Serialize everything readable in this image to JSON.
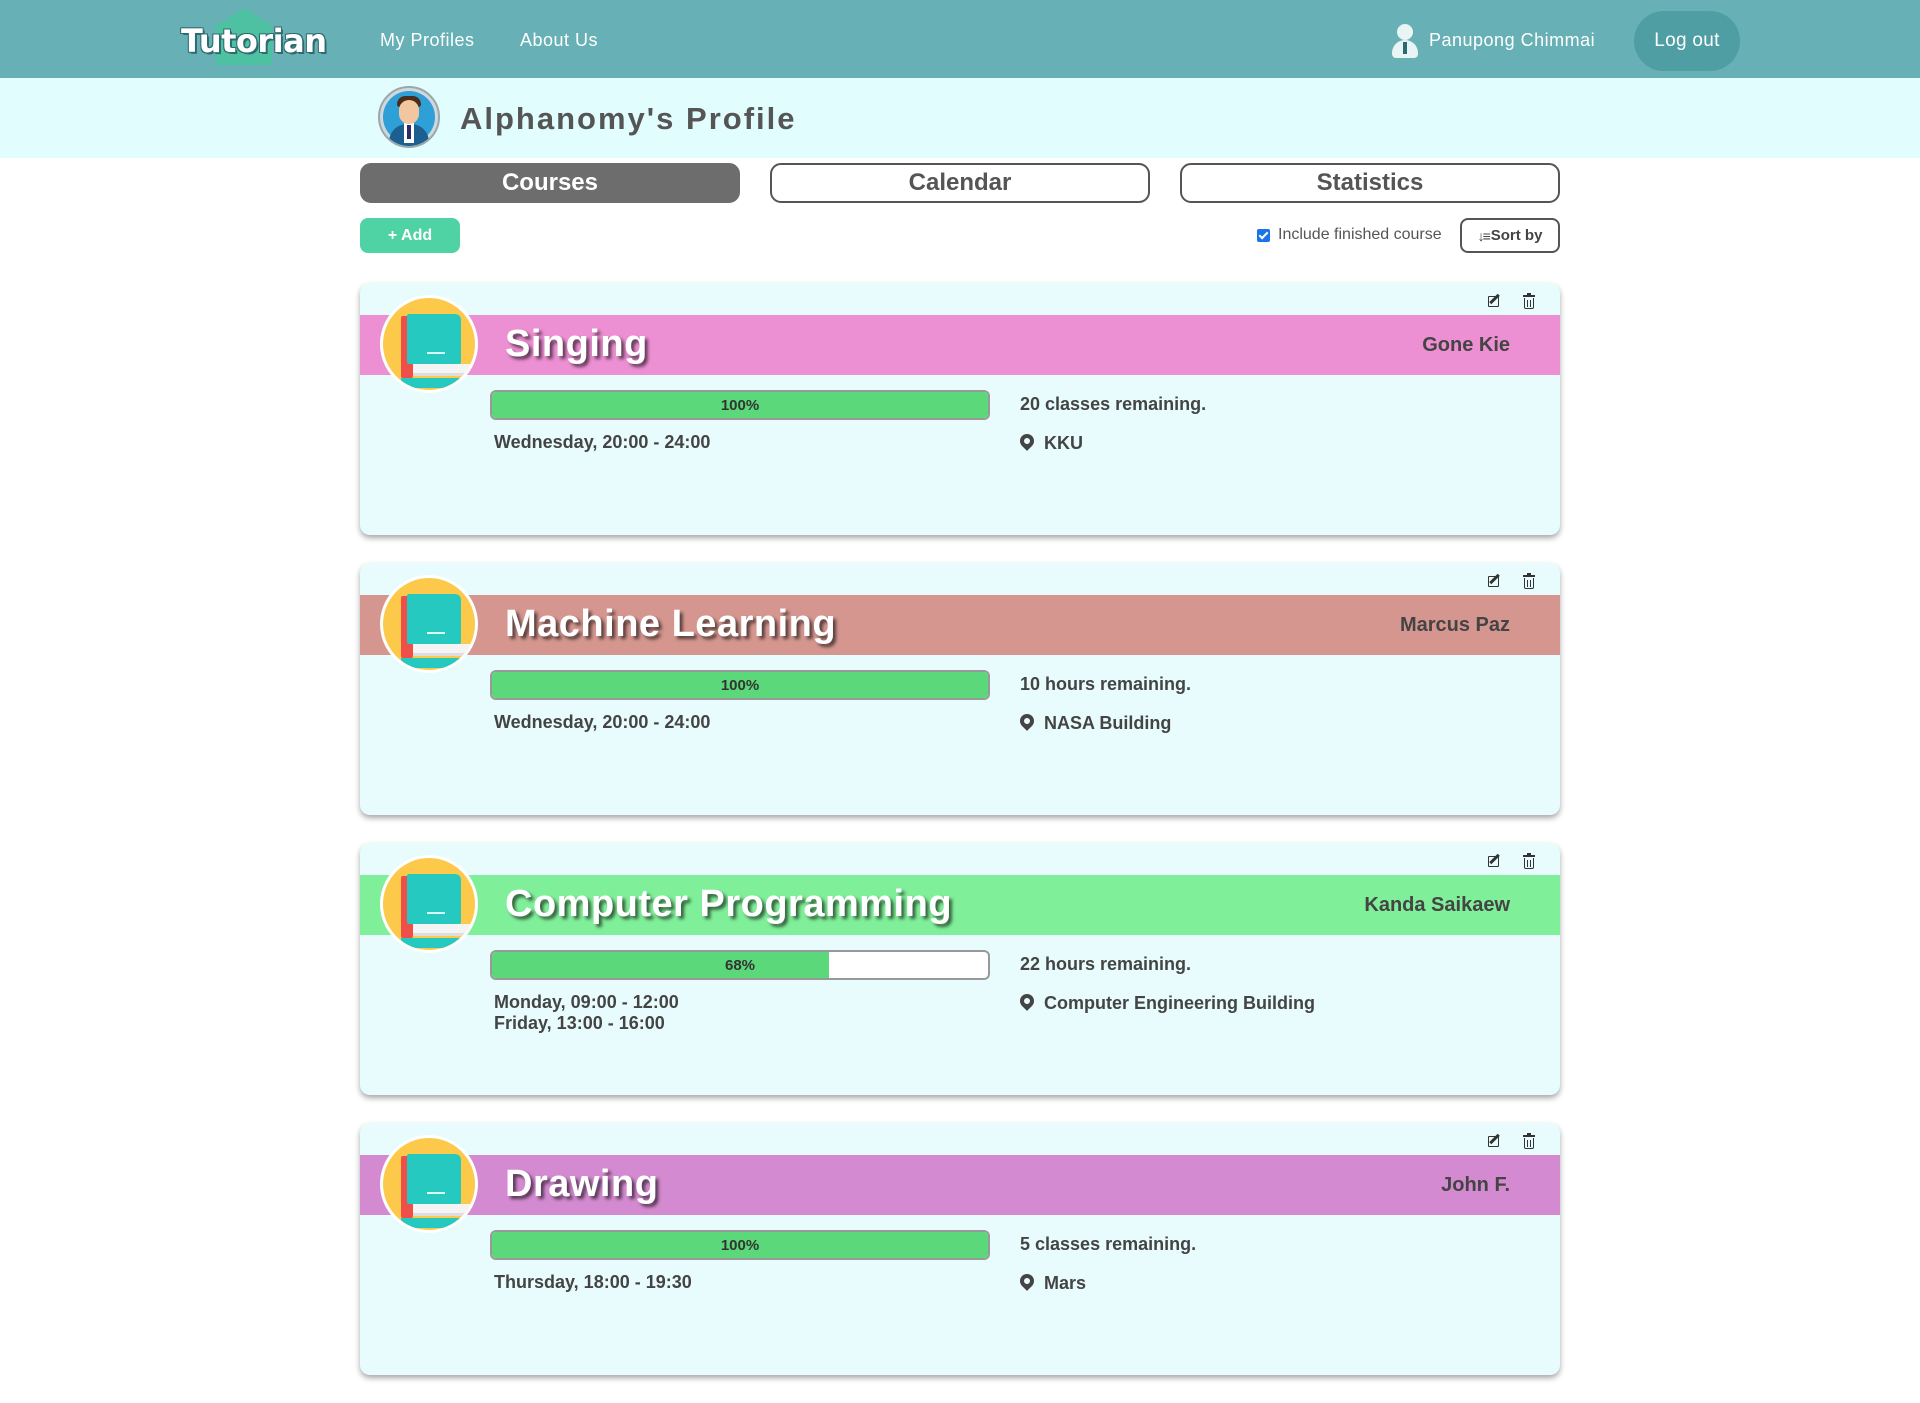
{
  "nav": {
    "logo": "Tutorian",
    "links": [
      "My Profiles",
      "About Us"
    ],
    "user_name": "Panupong Chimmai",
    "logout": "Log out"
  },
  "profile": {
    "title": "Alphanomy's Profile"
  },
  "tabs": [
    "Courses",
    "Calendar",
    "Statistics"
  ],
  "active_tab": "Courses",
  "toolbar": {
    "add": "+ Add",
    "include_finished": "Include finished course",
    "include_finished_checked": true,
    "sort_by": "Sort by"
  },
  "courses": [
    {
      "name": "Singing",
      "tutor": "Gone Kie",
      "color": "#ed8fd3",
      "progress": 100,
      "progress_label": "100%",
      "schedule": [
        "Wednesday, 20:00 - 24:00"
      ],
      "remaining": "20 classes remaining.",
      "location": "KKU"
    },
    {
      "name": "Machine Learning",
      "tutor": "Marcus Paz",
      "color": "#d5968f",
      "progress": 100,
      "progress_label": "100%",
      "schedule": [
        "Wednesday, 20:00 - 24:00"
      ],
      "remaining": "10 hours remaining.",
      "location": "NASA Building"
    },
    {
      "name": "Computer Programming",
      "tutor": "Kanda Saikaew",
      "color": "#80ef99",
      "progress": 68,
      "progress_label": "68%",
      "schedule": [
        "Monday, 09:00 - 12:00",
        "Friday, 13:00 - 16:00"
      ],
      "remaining": "22 hours remaining.",
      "location": "Computer Engineering Building"
    },
    {
      "name": "Drawing",
      "tutor": "John F.",
      "color": "#d48ad0",
      "progress": 100,
      "progress_label": "100%",
      "schedule": [
        "Thursday, 18:00 - 19:30"
      ],
      "remaining": "5 classes remaining.",
      "location": "Mars"
    }
  ]
}
